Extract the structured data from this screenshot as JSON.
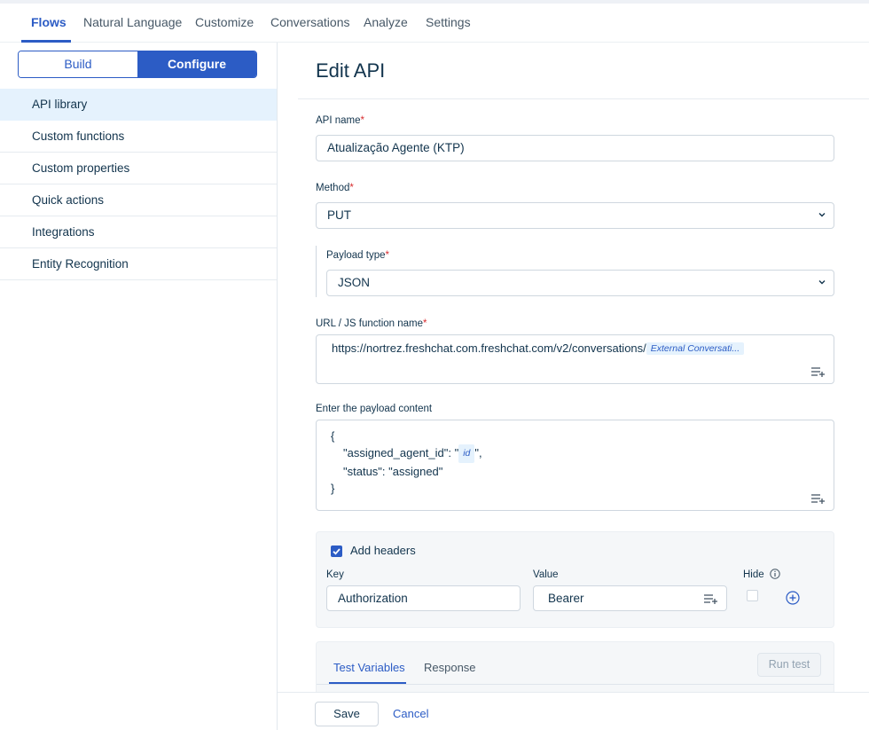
{
  "topnav": {
    "tabs": [
      {
        "label": "Flows"
      },
      {
        "label": "Natural Language"
      },
      {
        "label": "Customize"
      },
      {
        "label": "Conversations"
      },
      {
        "label": "Analyze"
      },
      {
        "label": "Settings"
      }
    ],
    "active": "Flows"
  },
  "sidebar": {
    "segment": {
      "build": "Build",
      "configure": "Configure",
      "selected": "Configure"
    },
    "items": [
      {
        "label": "API library"
      },
      {
        "label": "Custom functions"
      },
      {
        "label": "Custom properties"
      },
      {
        "label": "Quick actions"
      },
      {
        "label": "Integrations"
      },
      {
        "label": "Entity Recognition"
      }
    ],
    "active": "API library"
  },
  "form": {
    "title": "Edit API",
    "api_name": {
      "label": "API name",
      "required": "*",
      "value": "Atualização Agente (KTP)"
    },
    "method": {
      "label": "Method",
      "required": "*",
      "value": "PUT"
    },
    "payload_type": {
      "label": "Payload type",
      "required": "*",
      "value": "JSON"
    },
    "url": {
      "label": "URL / JS function name",
      "required": "*",
      "value": "https://nortrez.freshchat.com.freshchat.com/v2/conversations/",
      "variable": "External Conversati..."
    },
    "payload": {
      "label": "Enter the payload content",
      "open_brace": "{",
      "key1": "\"assigned_agent_id\": \"",
      "variable": "id",
      "key1_end": "\",",
      "line2": "\"status\": \"assigned\"",
      "close_brace": "}"
    },
    "headers": {
      "checkbox_label": "Add headers",
      "checked": true,
      "key_label": "Key",
      "value_label": "Value",
      "hide_label": "Hide",
      "row": {
        "key": "Authorization",
        "value": "Bearer",
        "hide": false
      }
    },
    "test": {
      "tabs": [
        {
          "label": "Test Variables"
        },
        {
          "label": "Response"
        }
      ],
      "active": "Test Variables",
      "run_label": "Run test"
    }
  },
  "footer": {
    "save": "Save",
    "cancel": "Cancel"
  },
  "colors": {
    "primary": "#2c5cc5",
    "active_bg": "#e5f2fd",
    "required": "#d72d30",
    "text": "#12344d"
  }
}
